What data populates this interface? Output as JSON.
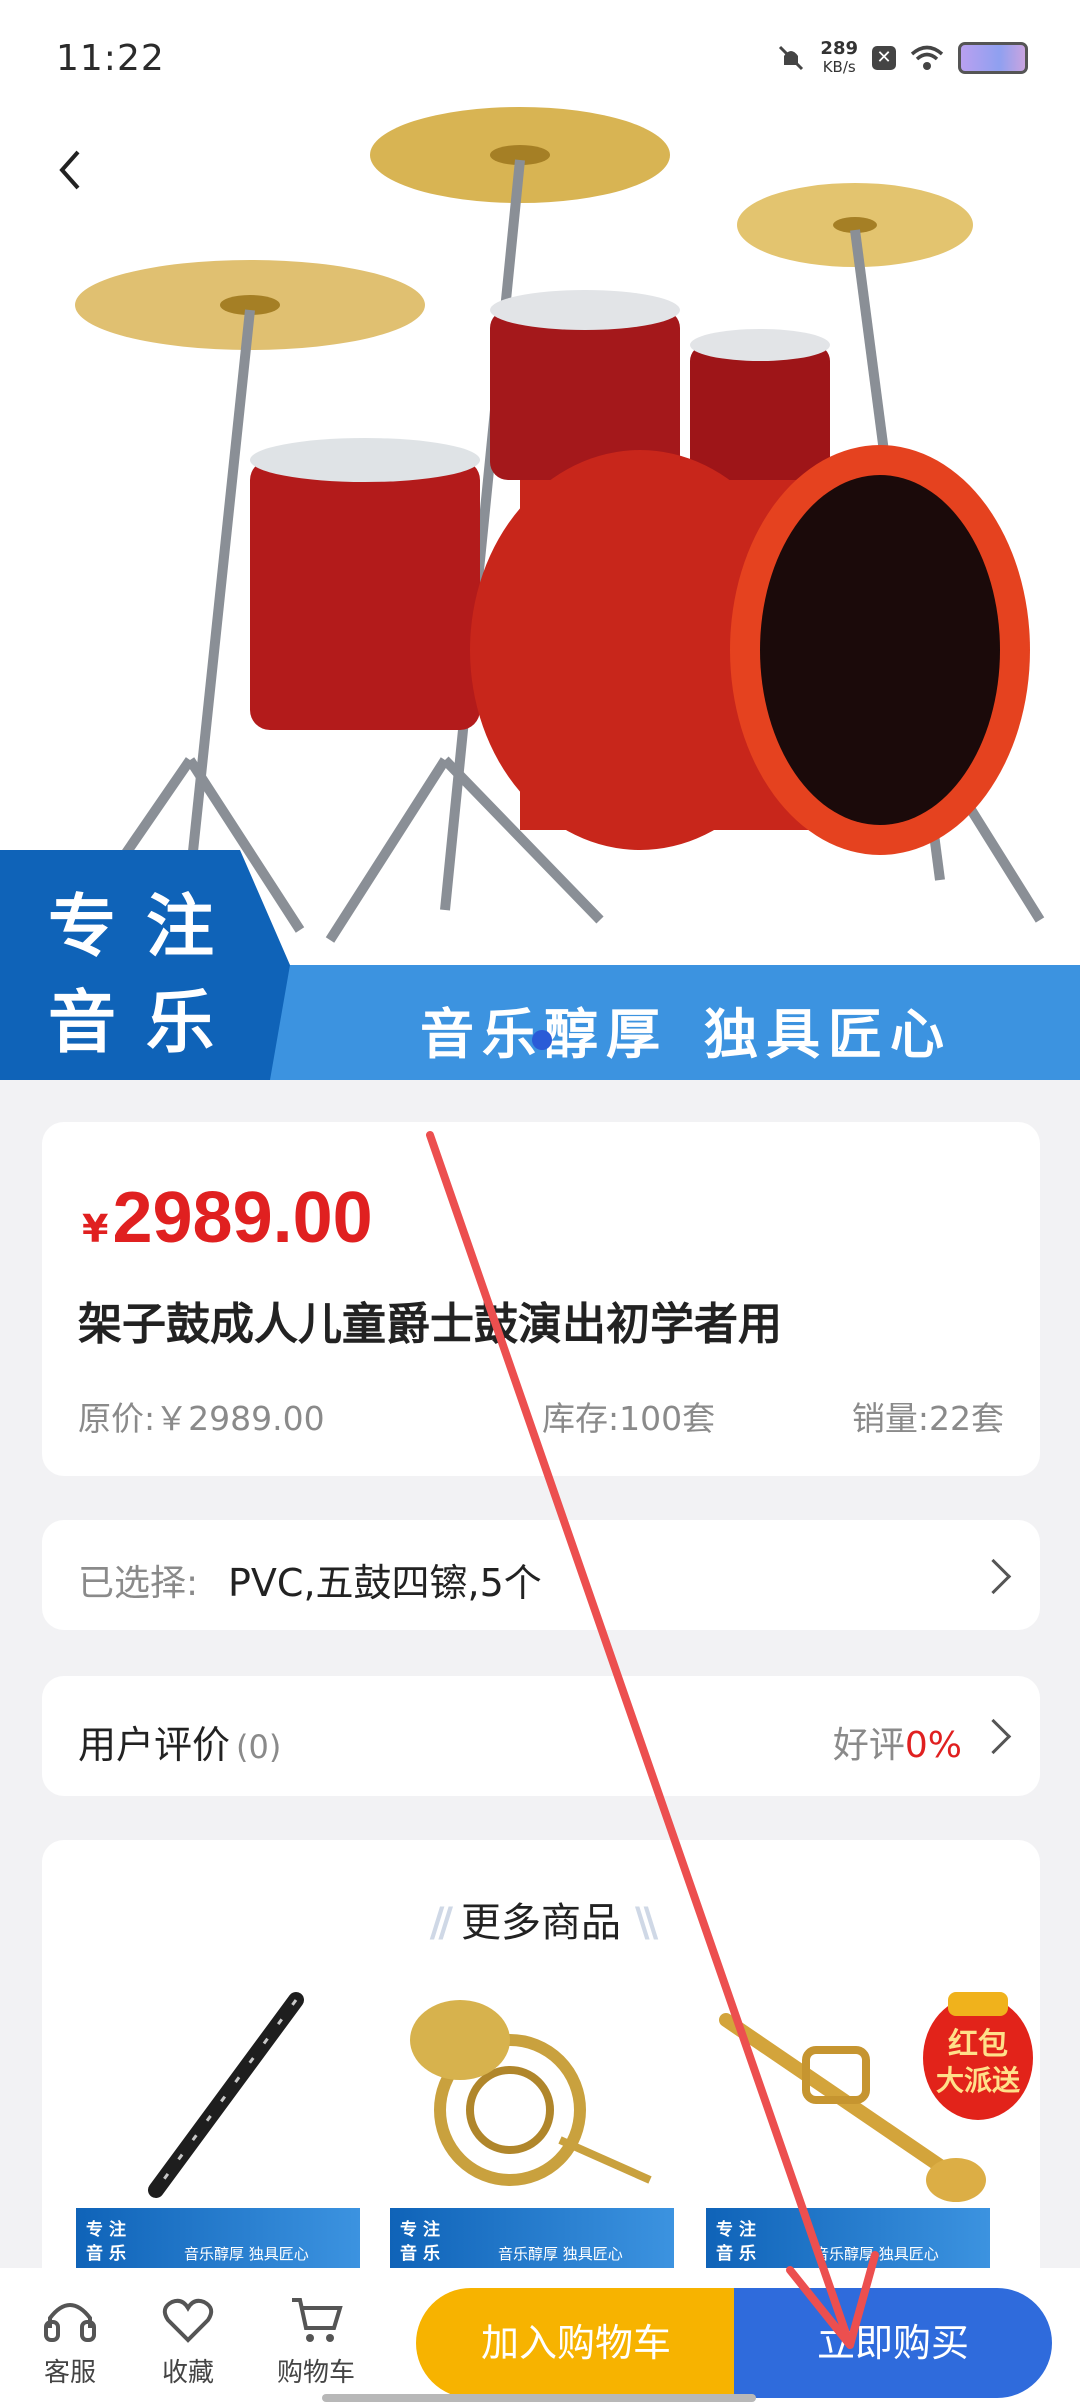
{
  "status": {
    "time": "11:22",
    "speed_value": "289",
    "speed_unit": "KB/s"
  },
  "banner": {
    "slogan_line1": "专注",
    "slogan_line2": "音乐",
    "tagline_a": "音乐醇厚",
    "tagline_b": "独具匠心"
  },
  "product": {
    "currency": "¥",
    "price": "2989.00",
    "title": "架子鼓成人儿童爵士鼓演出初学者用",
    "original_price": "原价:￥2989.00",
    "stock": "库存:100套",
    "sales": "销量:22套"
  },
  "selection": {
    "label": "已选择:",
    "value": "PVC,五鼓四镲,5个"
  },
  "reviews": {
    "label": "用户评价",
    "count": "(0)",
    "rate_label": "好评",
    "rate_value": "0%"
  },
  "more": {
    "title": "更多商品",
    "items": [
      {
        "name": "oboe",
        "tag_l1": "专注",
        "tag_l2": "音乐",
        "tag_r": "音乐醇厚  独具匠心"
      },
      {
        "name": "french-horn",
        "tag_l1": "专注",
        "tag_l2": "音乐",
        "tag_r": "音乐醇厚  独具匠心"
      },
      {
        "name": "trumpet",
        "tag_l1": "专注",
        "tag_l2": "音乐",
        "tag_r": "音乐醇厚  独具匠心"
      }
    ],
    "promo_line1": "红包",
    "promo_line2": "大派送"
  },
  "bottom": {
    "service": "客服",
    "favorite": "收藏",
    "cart": "购物车",
    "add_to_cart": "加入购物车",
    "buy_now": "立即购买"
  },
  "colors": {
    "price_red": "#e02020",
    "cart_yellow": "#f7b300",
    "buy_blue": "#2f6bdc",
    "banner_blue": "#0f63b8"
  },
  "icons": [
    "back-arrow-icon",
    "headset-icon",
    "heart-icon",
    "cart-icon",
    "chevron-right-icon"
  ]
}
